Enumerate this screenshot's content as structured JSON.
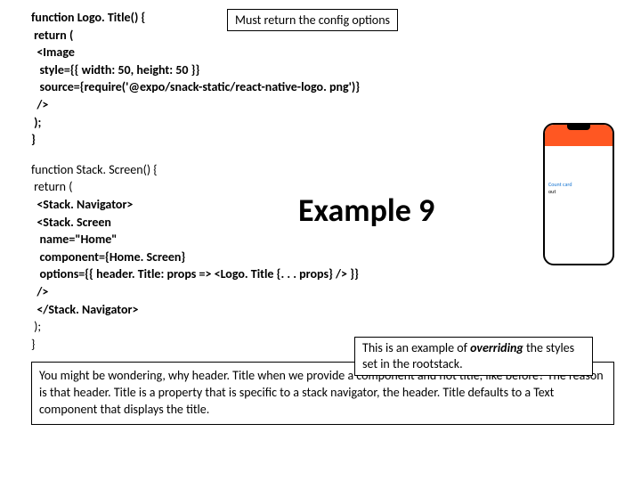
{
  "code1": {
    "l1": "function Logo. Title() {",
    "l2": " return (",
    "l3": "  <Image",
    "l4": "   style={{ width: 50, height: 50 }}",
    "l5": "   source={require('@expo/snack-static/react-native-logo. png')}",
    "l6": "  />",
    "l7": " );",
    "l8": "}"
  },
  "callout_config": "Must return the config options",
  "example_label": "Example 9",
  "code2": {
    "l1": "function Stack. Screen() {",
    "l2": " return (",
    "l3": "  <Stack. Navigator>",
    "l4": "  <Stack. Screen",
    "l5": "   name=\"Home\"",
    "l6": "   component={Home. Screen}",
    "l7": "   options={{ header. Title: props => <Logo. Title {. . . props} /> }}",
    "l8": "  />",
    "l9": "  </Stack. Navigator>",
    "l10": " );",
    "l11": "}"
  },
  "override_note": {
    "part1": "This is an example of ",
    "part2": "overriding",
    "part3": "the styles set in the rootstack."
  },
  "phone": {
    "text1": "Count card",
    "text2": "out"
  },
  "bottom": "You might be wondering, why header. Title when we provide a component and not title, like before? The reason is that header. Title is a property that is specific to a stack navigator, the header. Title defaults to a Text component that displays the title."
}
